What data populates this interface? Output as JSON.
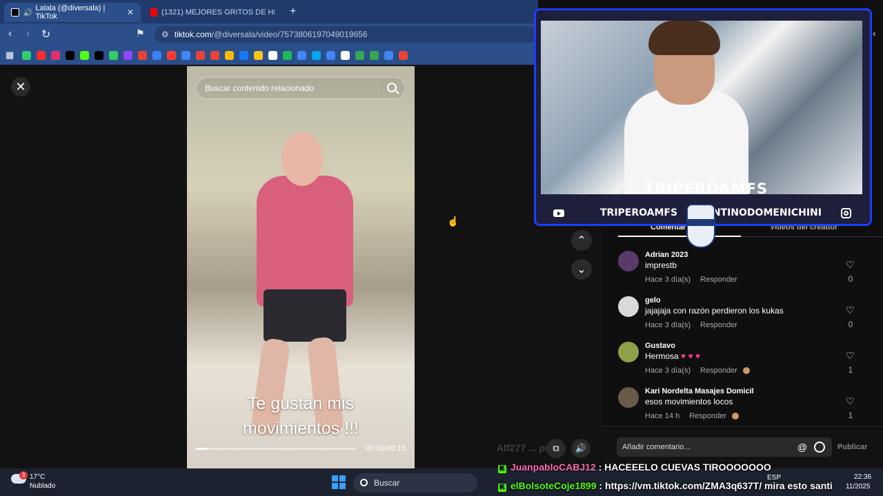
{
  "browser": {
    "tabs": [
      {
        "title": "Lalala (@diversala) | TikTok",
        "active": true,
        "icon_color": "#000000"
      },
      {
        "title": "(1321) MEJORES GRITOS DE HINCHA",
        "active": false,
        "icon_color": "#ff0000"
      }
    ],
    "url_host": "tiktok.com",
    "url_path": "/@diversala/video/7573806197049019656",
    "bookmark_colors": [
      "#2ecc71",
      "#ff2d2d",
      "#e1306c",
      "#000000",
      "#53fc18",
      "#000000",
      "#33cc66",
      "#9146ff",
      "#ea4335",
      "#3b82f6",
      "#ff3b30",
      "#4285f4",
      "#ea4335",
      "#ea4335",
      "#fbbc04",
      "#1877f2",
      "#f5c518",
      "#ffffff",
      "#1db954",
      "#4285f4",
      "#00a4ef",
      "#4285f4",
      "#ffffff",
      "#34a853",
      "#34a853",
      "#4285f4",
      "#ea4335"
    ]
  },
  "tiktok": {
    "search_placeholder": "Buscar contenido relacionado",
    "caption_line1": "Te gustan mis",
    "caption_line2": "movimientos !!!",
    "time": "00:01/00:15",
    "progress": 0.07,
    "tab_comments": "Comentar",
    "tab_creator_videos": "Videos del creador",
    "comments": [
      {
        "user": "Adrian 2023",
        "text": "imprestb",
        "time": "Hace 3 día(s)",
        "reply": "Responder",
        "likes": "0",
        "avatar_color": "#5a3a6a"
      },
      {
        "user": "gelo",
        "text": "jajajaja con razón perdieron los kukas",
        "time": "Hace 3 día(s)",
        "reply": "Responder",
        "likes": "0",
        "avatar_color": "#d9d9d9"
      },
      {
        "user": "Gustavo",
        "text": "Hermosa",
        "emoji": "♥ ♥ ♥",
        "time": "Hace 3 día(s)",
        "reply": "Responder",
        "likes": "1",
        "avatar_color": "#8fa04a"
      },
      {
        "user": "Kari Nordelta Masajes Domicil",
        "text": "esos movimientos locos",
        "time": "Hace 14 h",
        "reply": "Responder",
        "likes": "1",
        "avatar_color": "#6a5a4a"
      }
    ],
    "comment_placeholder": "Añadir comentario...",
    "at_symbol": "@",
    "publish_label": "Publicar"
  },
  "stream": {
    "streamer_name": "TRIPEROAMFS",
    "youtube_handle": "TRIPEROAMFS",
    "instagram_handle": "SANTINODOMENICHINI",
    "accent_color": "#1b3eff",
    "chat": [
      {
        "user": "JuanpabloCABJ12",
        "sep": " : ",
        "message": "HACEEELO CUEVAS TIROOOOOOO"
      },
      {
        "user": "elBolsoteCoje1899",
        "sep": " : ",
        "message": "https://vm.tiktok.com/ZMA3q637T/ mira esto santi"
      }
    ],
    "ghost_chat": "Alf277 ... pregu"
  },
  "taskbar": {
    "weather_temp": "17°C",
    "weather_desc": "Nublado",
    "weather_badge": "3",
    "search_label": "Buscar",
    "lang": "ESP",
    "time": "22:36",
    "date": "11/2025"
  }
}
